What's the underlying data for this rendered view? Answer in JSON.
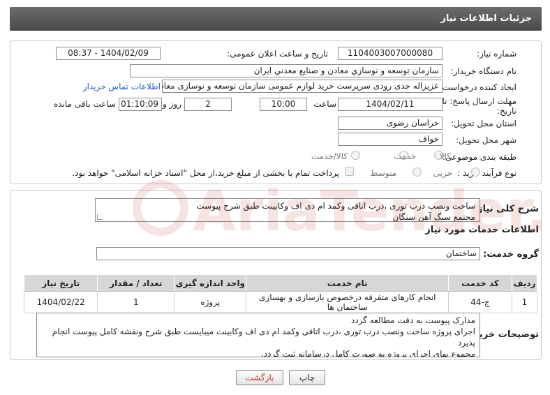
{
  "header": {
    "title": "جزئیات اطلاعات نیاز"
  },
  "form": {
    "need_number_label": "شماره نیاز:",
    "need_number": "1104003007000080",
    "announce_label": "تاریخ و ساعت اعلان عمومی:",
    "announce_value": "1404/02/09 - 08:37",
    "buyer_org_label": "نام دستگاه خریدار:",
    "buyer_org": "سازمان توسعه و نوسازي معادن و صنايع معدني ايران",
    "requester_label": "ایجاد کننده درخواست:",
    "requester": "عزیزاله جدی رودی سرپرست خرید لوازم عمومی  سازمان توسعه و نوسازی معادن و صنایع معدنی ایران",
    "contact_link": "اطلاعات تماس خریدار",
    "deadline_label_1": "مهلت ارسال پاسخ: تا",
    "deadline_label_2": "تاریخ:",
    "deadline_date": "1404/02/11",
    "time_label": "ساعت",
    "deadline_time": "10:00",
    "days_value": "2",
    "days_label": "روز و",
    "remaining_value": "01:10:09",
    "remaining_label": "ساعت باقی مانده",
    "province_label": "استان محل تحویل:",
    "province": "خراسان رضوی",
    "city_label": "شهر محل تحویل:",
    "city": "خواف",
    "category_label": "طبقه بندی موضوعی:",
    "category_options": [
      "کالا",
      "خدمت",
      "کالا/خدمت"
    ],
    "process_label": "نوع فرآیند خرید :",
    "process_options": [
      "جزیی",
      "متوسط"
    ],
    "payment_note": "پرداخت تمام یا بخشی از مبلغ خرید،از محل \"اسناد خزانه اسلامی\" خواهد بود."
  },
  "summary": {
    "label": "شرح کلی نیاز:",
    "line1": "ساخت ونصب درب توری ،درب اتاقی وکمد ام دی اف وکابینت طبق شرح پیوست",
    "line2": "مجتمع سنگ آهن سنگان"
  },
  "services": {
    "section_title": "اطلاعات خدمات مورد نیاز",
    "group_label": "گروه خدمت:",
    "group_value": "ساختمان",
    "columns": [
      "ردیف",
      "کد خدمت",
      "نام خدمت",
      "واحد اندازه گیری",
      "تعداد / مقدار",
      "تاریخ نیاز"
    ],
    "rows": [
      [
        "1",
        "ج-44",
        "انجام کارهای متفرقه درخصوص بازسازی و بهسازی ساختمان ها",
        "پروژه",
        "1",
        "1404/02/22"
      ]
    ]
  },
  "buyer_notes": {
    "label": "توضیحات خریدار:",
    "line1": "مدارک پیوست به دقت مطالعه گردد",
    "line2": "اجرای پروژه ساخت ونصب درب توری ،درب اتاقی وکمد ام دی اف وکابینت میبایست طبق شرح ونقشه کامل پیوست انجام",
    "line3": "پذیرد",
    "line4": "مجموع بهای اجرای پروژه به صورت کامل درسامانه ثبت گردد."
  },
  "actions": {
    "print": "چاپ",
    "back": "بازگشت"
  },
  "watermark_text": "AriaTender.neT",
  "colors": {
    "header_bg": "#5a5a5a",
    "link": "#1a5ccf",
    "back_text": "#c0392b",
    "watermark": "#c0392b"
  }
}
